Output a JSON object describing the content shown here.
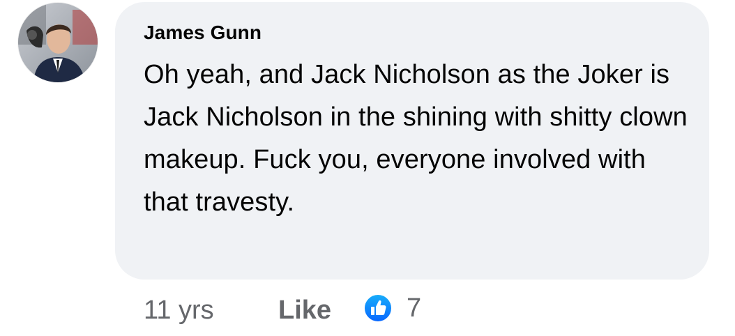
{
  "comment": {
    "author": "James Gunn",
    "text": "Oh yeah, and Jack Nicholson as the Joker is Jack Nicholson in the shining with shitty clown makeup. Fuck you, everyone involved with that travesty.",
    "timestamp": "11 yrs",
    "like_label": "Like",
    "reaction_count": "7",
    "reaction_icon": "thumbs-up-icon"
  },
  "colors": {
    "bubble_bg": "#f0f2f5",
    "text": "#050505",
    "meta_text": "#65676b",
    "like_reaction_blue": "#1877f2"
  }
}
